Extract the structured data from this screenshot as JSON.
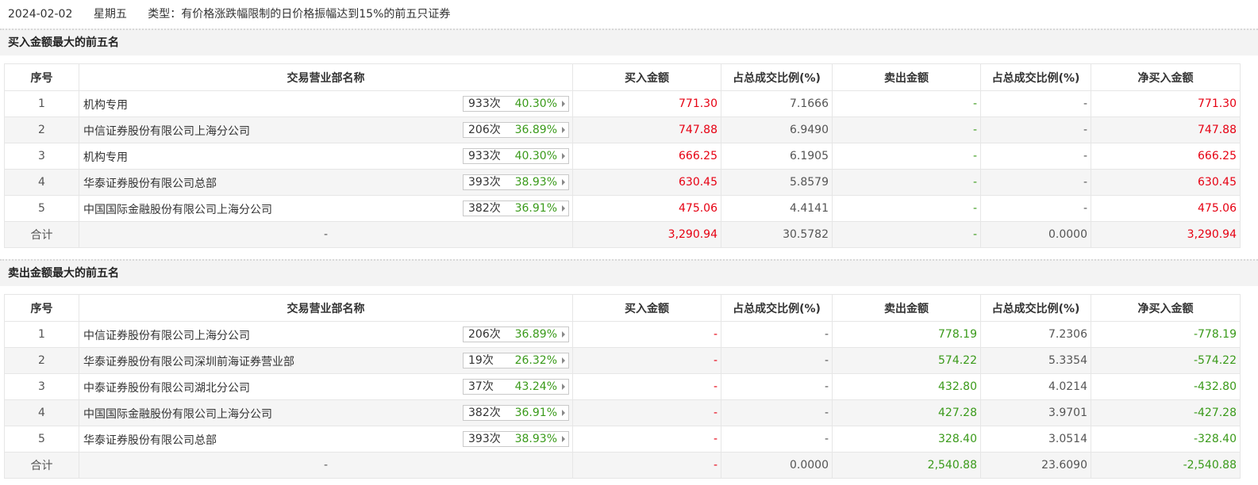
{
  "header": {
    "date": "2024-02-02",
    "weekday": "星期五",
    "type": "类型：有价格涨跌幅限制的日价格振幅达到15%的前五只证券"
  },
  "columns": [
    "序号",
    "交易营业部名称",
    "买入金额",
    "占总成交比例(%)",
    "卖出金额",
    "占总成交比例(%)",
    "净买入金额"
  ],
  "buy_section": {
    "title": "买入金额最大的前五名",
    "rows": [
      {
        "idx": "1",
        "name": "机构专用",
        "count": "933次",
        "pct": "40.30%",
        "buy": "771.30",
        "buy_ratio": "7.1666",
        "sell": "-",
        "sell_ratio": "-",
        "net": "771.30"
      },
      {
        "idx": "2",
        "name": "中信证券股份有限公司上海分公司",
        "count": "206次",
        "pct": "36.89%",
        "buy": "747.88",
        "buy_ratio": "6.9490",
        "sell": "-",
        "sell_ratio": "-",
        "net": "747.88"
      },
      {
        "idx": "3",
        "name": "机构专用",
        "count": "933次",
        "pct": "40.30%",
        "buy": "666.25",
        "buy_ratio": "6.1905",
        "sell": "-",
        "sell_ratio": "-",
        "net": "666.25"
      },
      {
        "idx": "4",
        "name": "华泰证券股份有限公司总部",
        "count": "393次",
        "pct": "38.93%",
        "buy": "630.45",
        "buy_ratio": "5.8579",
        "sell": "-",
        "sell_ratio": "-",
        "net": "630.45"
      },
      {
        "idx": "5",
        "name": "中国国际金融股份有限公司上海分公司",
        "count": "382次",
        "pct": "36.91%",
        "buy": "475.06",
        "buy_ratio": "4.4141",
        "sell": "-",
        "sell_ratio": "-",
        "net": "475.06"
      }
    ],
    "total": {
      "label": "合计",
      "name": "-",
      "buy": "3,290.94",
      "buy_ratio": "30.5782",
      "sell": "-",
      "sell_ratio": "0.0000",
      "net": "3,290.94"
    }
  },
  "sell_section": {
    "title": "卖出金额最大的前五名",
    "rows": [
      {
        "idx": "1",
        "name": "中信证券股份有限公司上海分公司",
        "count": "206次",
        "pct": "36.89%",
        "buy": "-",
        "buy_ratio": "-",
        "sell": "778.19",
        "sell_ratio": "7.2306",
        "net": "-778.19"
      },
      {
        "idx": "2",
        "name": "华泰证券股份有限公司深圳前海证券营业部",
        "count": "19次",
        "pct": "26.32%",
        "buy": "-",
        "buy_ratio": "-",
        "sell": "574.22",
        "sell_ratio": "5.3354",
        "net": "-574.22"
      },
      {
        "idx": "3",
        "name": "中泰证券股份有限公司湖北分公司",
        "count": "37次",
        "pct": "43.24%",
        "buy": "-",
        "buy_ratio": "-",
        "sell": "432.80",
        "sell_ratio": "4.0214",
        "net": "-432.80"
      },
      {
        "idx": "4",
        "name": "中国国际金融股份有限公司上海分公司",
        "count": "382次",
        "pct": "36.91%",
        "buy": "-",
        "buy_ratio": "-",
        "sell": "427.28",
        "sell_ratio": "3.9701",
        "net": "-427.28"
      },
      {
        "idx": "5",
        "name": "华泰证券股份有限公司总部",
        "count": "393次",
        "pct": "38.93%",
        "buy": "-",
        "buy_ratio": "-",
        "sell": "328.40",
        "sell_ratio": "3.0514",
        "net": "-328.40"
      }
    ],
    "total": {
      "label": "合计",
      "name": "-",
      "buy": "-",
      "buy_ratio": "0.0000",
      "sell": "2,540.88",
      "sell_ratio": "23.6090",
      "net": "-2,540.88"
    }
  },
  "colors": {
    "buy": "#e60012",
    "sell": "#3a9a1a",
    "row_alt": "#f5f5f5"
  },
  "icons": {
    "detail_arrow": "caret-right-icon"
  }
}
